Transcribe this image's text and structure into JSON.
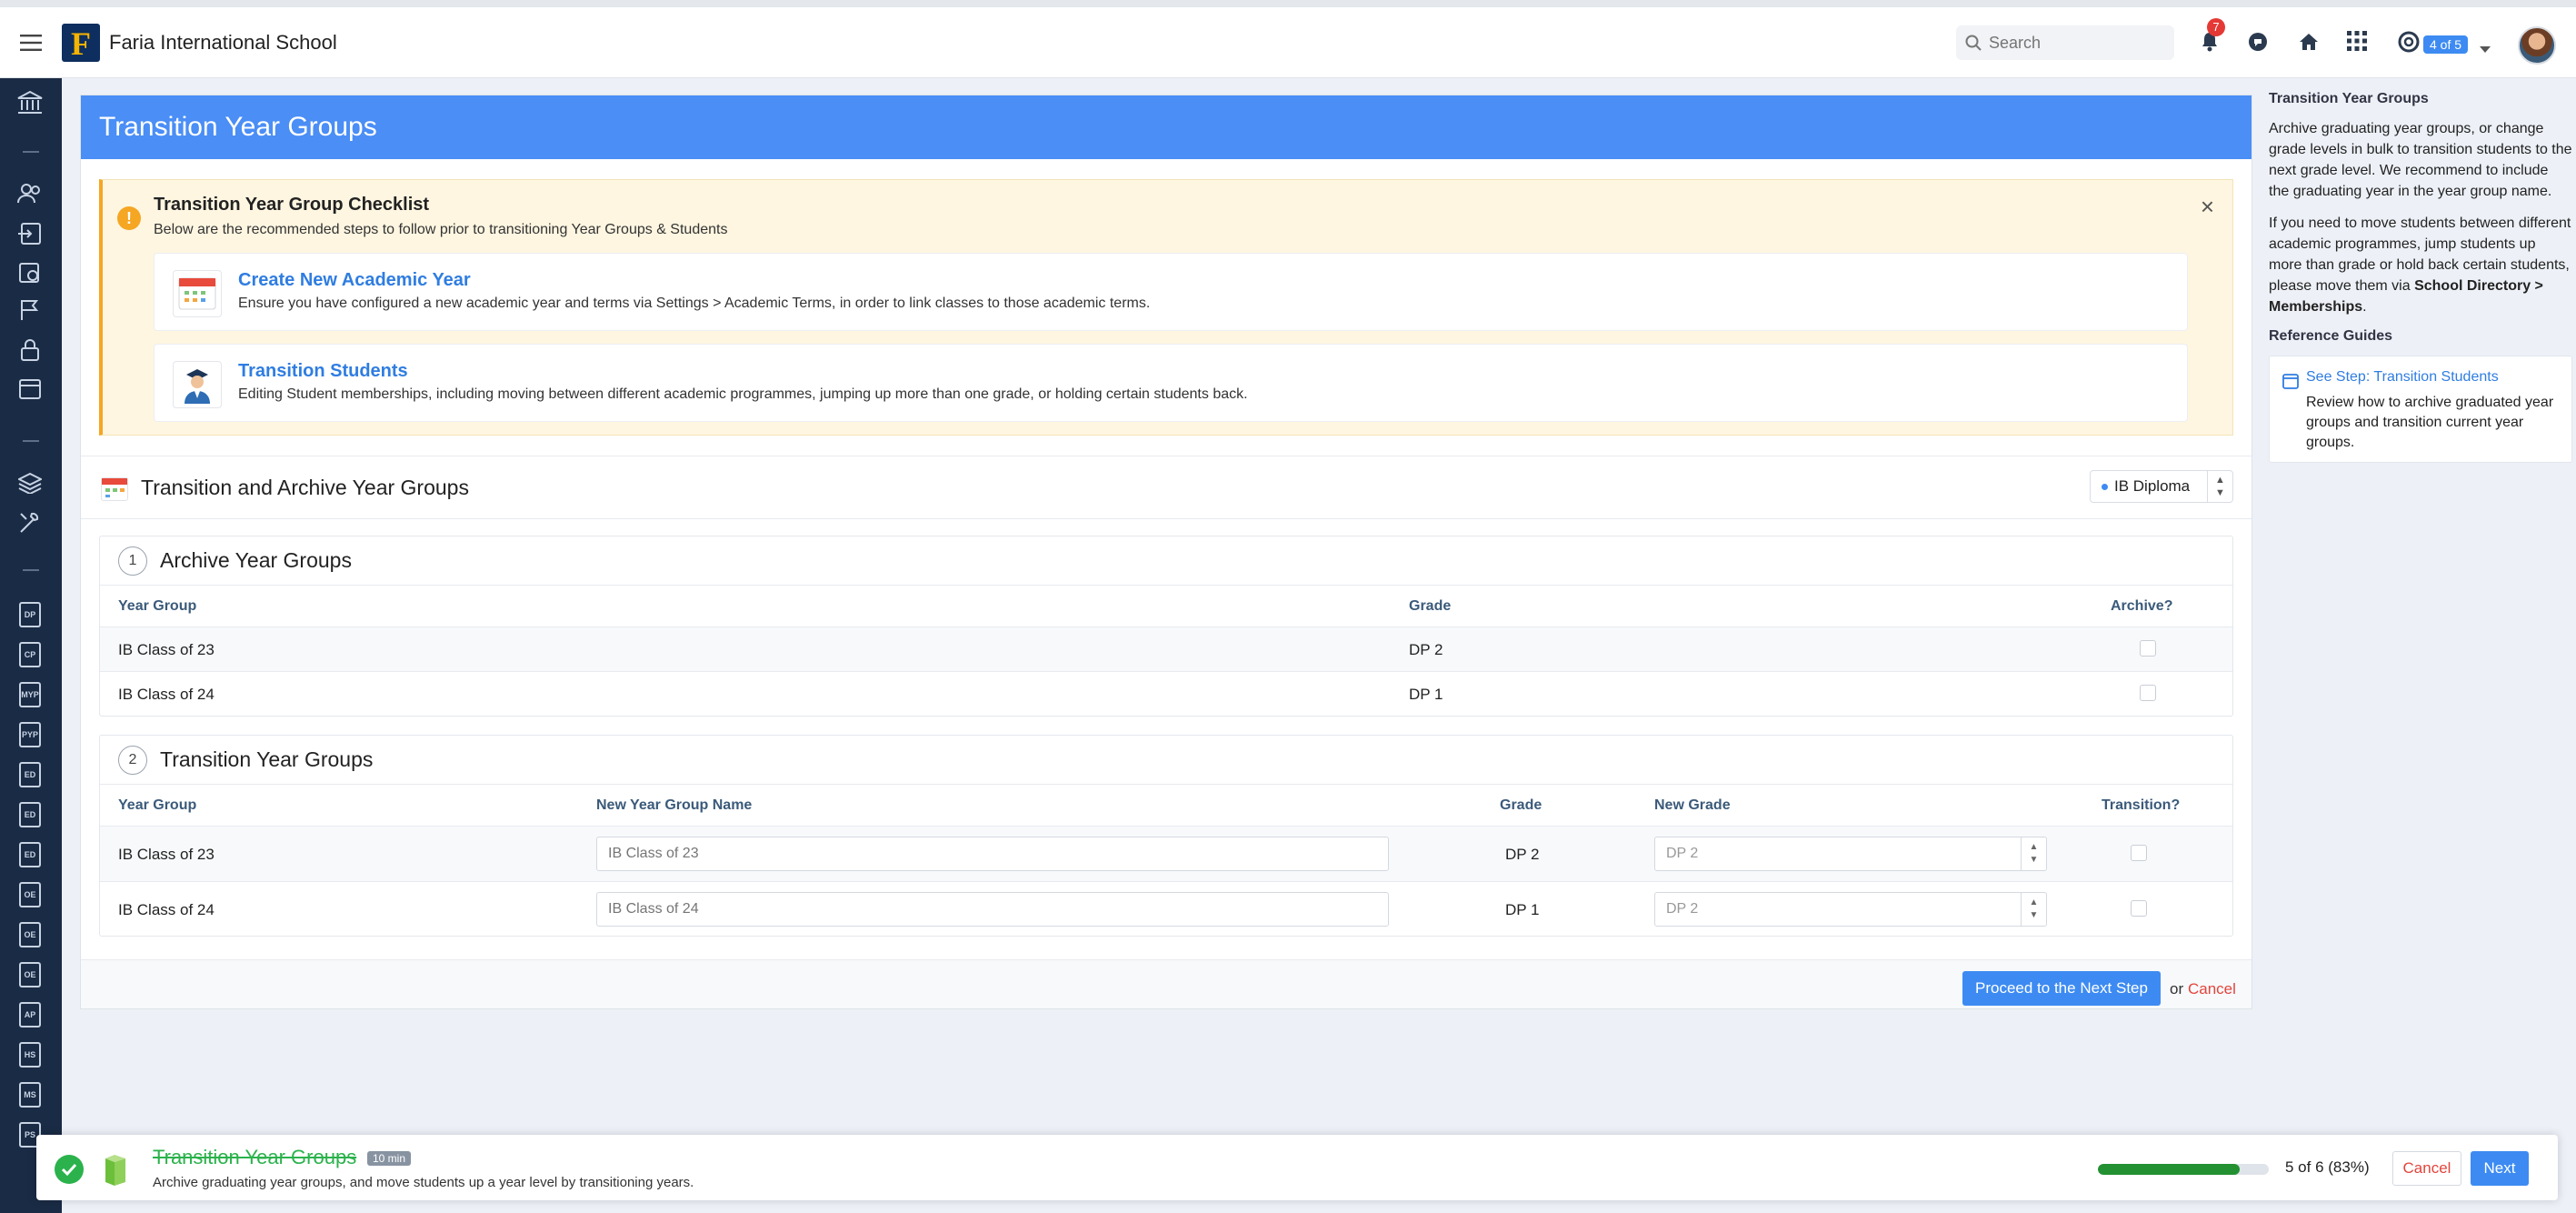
{
  "header": {
    "school_name": "Faria International School",
    "logo_letter": "F",
    "search_placeholder": "Search",
    "notification_count": "7",
    "profile_count": "4 of 5"
  },
  "page": {
    "title": "Transition Year Groups"
  },
  "checklist": {
    "title": "Transition Year Group Checklist",
    "subtitle": "Below are the recommended steps to follow prior to transitioning Year Groups & Students",
    "steps": [
      {
        "title": "Create New Academic Year",
        "description": "Ensure you have configured a new academic year and terms via Settings > Academic Terms, in order to link classes to those academic terms."
      },
      {
        "title": "Transition Students",
        "description": "Editing Student memberships, including moving between different academic programmes, jumping up more than one grade, or holding certain students back."
      }
    ]
  },
  "section": {
    "title": "Transition and Archive Year Groups",
    "programme": "IB Diploma"
  },
  "archive": {
    "number": "1",
    "title": "Archive Year Groups",
    "headers": {
      "year_group": "Year Group",
      "grade": "Grade",
      "archive": "Archive?"
    },
    "rows": [
      {
        "year_group": "IB Class of 23",
        "grade": "DP 2"
      },
      {
        "year_group": "IB Class of 24",
        "grade": "DP 1"
      }
    ]
  },
  "transition": {
    "number": "2",
    "title": "Transition Year Groups",
    "headers": {
      "year_group": "Year Group",
      "new_name": "New Year Group Name",
      "grade": "Grade",
      "new_grade": "New Grade",
      "transition": "Transition?"
    },
    "rows": [
      {
        "year_group": "IB Class of 23",
        "new_name_placeholder": "IB Class of 23",
        "grade": "DP 2",
        "new_grade": "DP 2"
      },
      {
        "year_group": "IB Class of 24",
        "new_name_placeholder": "IB Class of 24",
        "grade": "DP 1",
        "new_grade": "DP 2"
      }
    ]
  },
  "actions": {
    "proceed": "Proceed to the Next Step",
    "or": "or",
    "cancel": "Cancel"
  },
  "sidebar": {
    "title": "Transition Year Groups",
    "paragraph1": "Archive graduating year groups, or change grade levels in bulk to transition students to the next grade level. We recommend to include the graduating year in the year group name.",
    "paragraph2_prefix": "If you need to move students between different academic programmes, jump students up more than grade or hold back certain students, please move them via ",
    "paragraph2_bold": "School Directory > Memberships",
    "paragraph2_suffix": ".",
    "ref_title": "Reference Guides",
    "ref_link": "See Step: Transition Students",
    "ref_desc": "Review how to archive graduated year groups and transition current year groups."
  },
  "nav_docs": [
    "DP",
    "CP",
    "MYP",
    "PYP",
    "ED",
    "ED",
    "ED",
    "OE",
    "OE",
    "OE",
    "AP",
    "HS",
    "MS",
    "PS"
  ],
  "toast": {
    "title": "Transition Year Groups",
    "duration": "10 min",
    "subtitle": "Archive graduating year groups, and move students up a year level by transitioning years.",
    "progress_percent": 83,
    "progress_text": "5 of 6 (83%)",
    "cancel": "Cancel",
    "next": "Next"
  },
  "colors": {
    "accent": "#3d8bf2",
    "header_blue": "#4a8ef6",
    "nav_bg": "#1a2b45",
    "success": "#2bb24c",
    "danger": "#e2453c",
    "warning": "#f5a623"
  }
}
